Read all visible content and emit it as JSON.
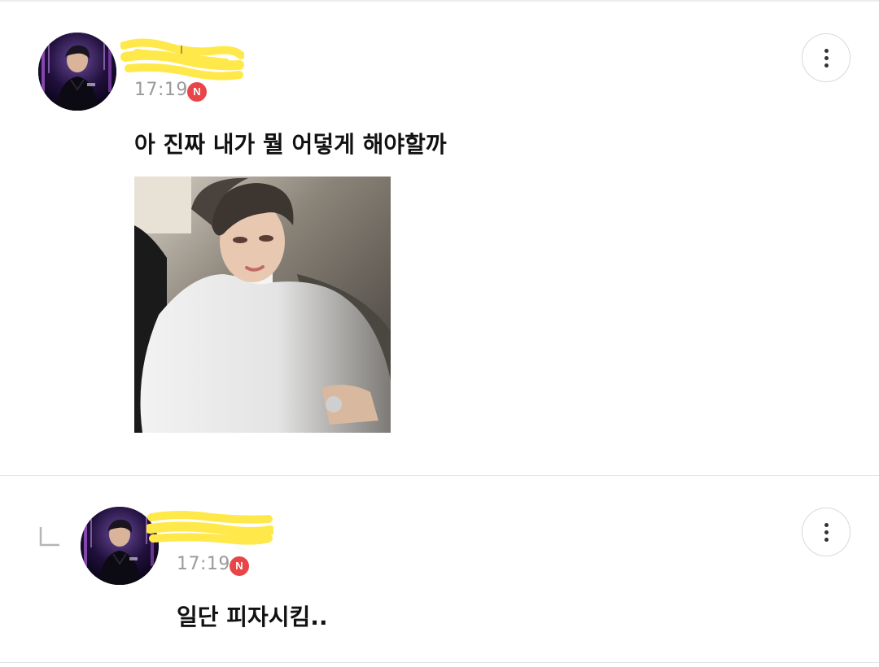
{
  "post": {
    "time": "17:19",
    "badge": "N",
    "message": "아 진짜 내가 뭘 어덯게 해야할까",
    "avatar_icon": "profile-avatar",
    "more_icon": "more-vertical-icon"
  },
  "reply": {
    "time": "17:19",
    "badge": "N",
    "message": "일단 피자시킴..",
    "reply_icon": "reply-arrow-icon",
    "more_icon": "more-vertical-icon"
  },
  "colors": {
    "badge": "#e84548",
    "highlight": "#ffe94a",
    "time": "#9a9a9a"
  }
}
